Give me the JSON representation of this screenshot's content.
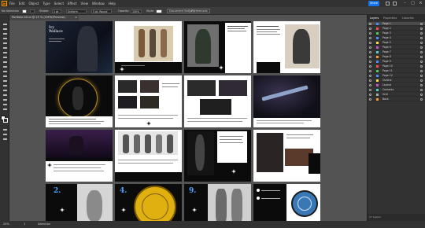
{
  "app": {
    "logo": "Ai",
    "share_label": "Share"
  },
  "menubar": {
    "items": [
      "File",
      "Edit",
      "Object",
      "Type",
      "Select",
      "Effect",
      "View",
      "Window",
      "Help"
    ]
  },
  "control": {
    "selection_label": "No Selection",
    "stroke_label": "Stroke:",
    "stroke_value": "1 pt",
    "brush_value": "Uniform",
    "brush_def": "5 pt. Round",
    "opacity_label": "Opacity:",
    "opacity_value": "100%",
    "style_label": "Style:",
    "doc_setup_label": "Document Setup",
    "prefs_label": "Preferences"
  },
  "document": {
    "tab_title": "Portfolio 4G.ai @ 25 % (CMYK/Preview)",
    "close": "×"
  },
  "status": {
    "zoom": "25%",
    "artboard": "1",
    "tool": "Selection"
  },
  "panel": {
    "tabs": [
      "Layers",
      "Properties",
      "Libraries"
    ],
    "layers": [
      {
        "name": "Page 1",
        "color": "#4f8dff"
      },
      {
        "name": "Page 2",
        "color": "#ff4f4f"
      },
      {
        "name": "Page 3",
        "color": "#4fd14f"
      },
      {
        "name": "Page 4",
        "color": "#4f8dff"
      },
      {
        "name": "Page 5",
        "color": "#ffd84f"
      },
      {
        "name": "Page 6",
        "color": "#d14fd1"
      },
      {
        "name": "Page 7",
        "color": "#4fd1d1"
      },
      {
        "name": "Page 8",
        "color": "#ff9a3c"
      },
      {
        "name": "Page 9",
        "color": "#4f8dff"
      },
      {
        "name": "Page 10",
        "color": "#ff4f4f"
      },
      {
        "name": "Page 11",
        "color": "#4fd14f"
      },
      {
        "name": "Page 12",
        "color": "#4f8dff"
      },
      {
        "name": "Outline",
        "color": "#ffd84f"
      },
      {
        "name": "Layout",
        "color": "#d14fd1"
      },
      {
        "name": "Contents",
        "color": "#4fd1d1"
      },
      {
        "name": "Grid",
        "color": "#aaaaaa"
      },
      {
        "name": "Back",
        "color": "#ff9a3c"
      }
    ],
    "footer": "17 Layers"
  },
  "board1": {
    "title_line1": "Ivy",
    "title_line2": "Wallace"
  },
  "board17": {
    "numbers": [
      "2.",
      "4.",
      "9."
    ]
  }
}
